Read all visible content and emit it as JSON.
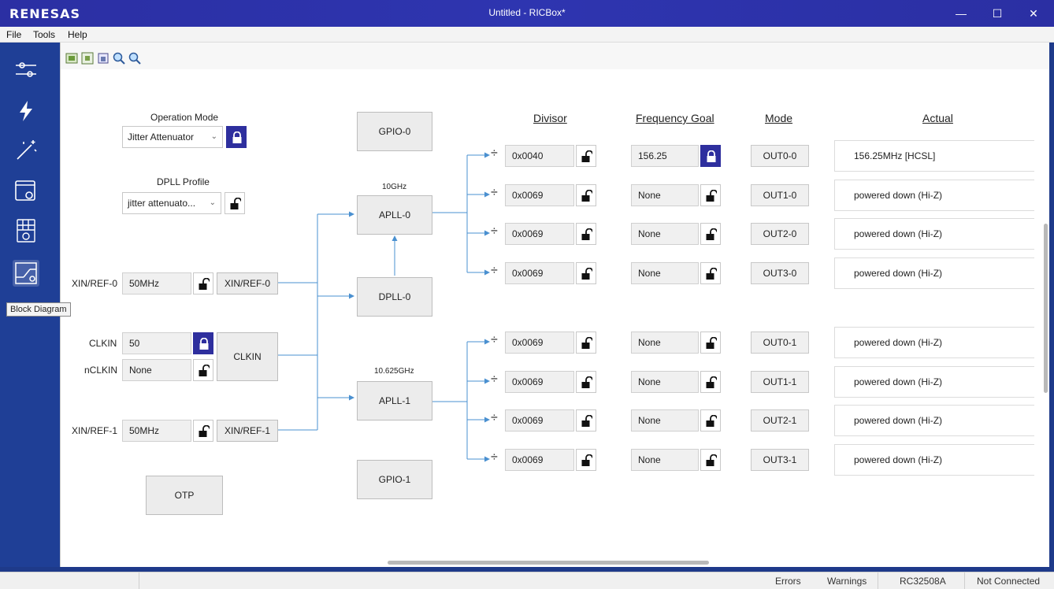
{
  "app": {
    "logo": "RENESAS",
    "window_title": "Untitled - RICBox*"
  },
  "window_controls": {
    "minimize": "—",
    "maximize": "☐",
    "close": "✕"
  },
  "menu": [
    "File",
    "Tools",
    "Help"
  ],
  "sidebar": {
    "tooltip": "Block Diagram"
  },
  "inputs": {
    "operation_mode": {
      "label": "Operation Mode",
      "value": "Jitter Attenuator"
    },
    "dpll_profile": {
      "label": "DPLL Profile",
      "value": "jitter attenuato..."
    },
    "xin_ref_0": {
      "label": "XIN/REF-0",
      "value": "50MHz",
      "block": "XIN/REF-0"
    },
    "clkin": {
      "label": "CLKIN",
      "value": "50",
      "block": "CLKIN"
    },
    "nclkin": {
      "label": "nCLKIN",
      "value": "None"
    },
    "xin_ref_1": {
      "label": "XIN/REF-1",
      "value": "50MHz",
      "block": "XIN/REF-1"
    }
  },
  "blocks": {
    "gpio0": "GPIO-0",
    "gpio1": "GPIO-1",
    "apll0": "APLL-0",
    "apll0_freq": "10GHz",
    "apll1": "APLL-1",
    "apll1_freq": "10.625GHz",
    "dpll0": "DPLL-0",
    "otp": "OTP"
  },
  "headers": {
    "divisor": "Divisor",
    "frequency_goal": "Frequency Goal",
    "mode": "Mode",
    "actual": "Actual"
  },
  "outputs": [
    {
      "divisor": "0x0040",
      "div_locked": false,
      "freq": "156.25",
      "freq_locked": true,
      "mode": "OUT0-0",
      "actual": "156.25MHz [HCSL]"
    },
    {
      "divisor": "0x0069",
      "div_locked": false,
      "freq": "None",
      "freq_locked": false,
      "mode": "OUT1-0",
      "actual": "powered down (Hi-Z)"
    },
    {
      "divisor": "0x0069",
      "div_locked": false,
      "freq": "None",
      "freq_locked": false,
      "mode": "OUT2-0",
      "actual": "powered down (Hi-Z)"
    },
    {
      "divisor": "0x0069",
      "div_locked": false,
      "freq": "None",
      "freq_locked": false,
      "mode": "OUT3-0",
      "actual": "powered down (Hi-Z)"
    },
    {
      "divisor": "0x0069",
      "div_locked": false,
      "freq": "None",
      "freq_locked": false,
      "mode": "OUT0-1",
      "actual": "powered down (Hi-Z)"
    },
    {
      "divisor": "0x0069",
      "div_locked": false,
      "freq": "None",
      "freq_locked": false,
      "mode": "OUT1-1",
      "actual": "powered down (Hi-Z)"
    },
    {
      "divisor": "0x0069",
      "div_locked": false,
      "freq": "None",
      "freq_locked": false,
      "mode": "OUT2-1",
      "actual": "powered down (Hi-Z)"
    },
    {
      "divisor": "0x0069",
      "div_locked": false,
      "freq": "None",
      "freq_locked": false,
      "mode": "OUT3-1",
      "actual": "powered down (Hi-Z)"
    }
  ],
  "divide_symbol": "÷",
  "status": {
    "errors": "Errors",
    "warnings": "Warnings",
    "device": "RC32508A",
    "connection": "Not Connected"
  }
}
